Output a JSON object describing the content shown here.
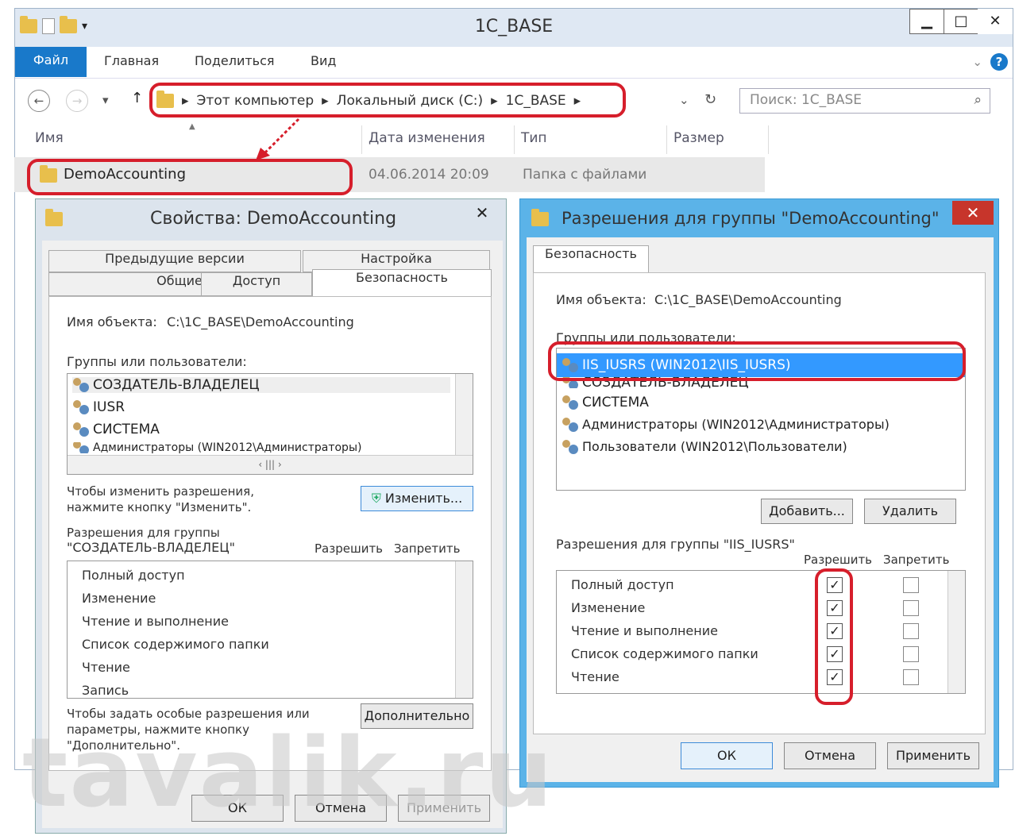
{
  "explorer": {
    "title": "1C_BASE",
    "ribbon": {
      "file": "Файл",
      "home": "Главная",
      "share": "Поделиться",
      "view": "Вид"
    },
    "path": [
      "Этот компьютер",
      "Локальный диск (C:)",
      "1C_BASE"
    ],
    "search_placeholder": "Поиск: 1C_BASE",
    "columns": [
      "Имя",
      "Дата изменения",
      "Тип",
      "Размер"
    ],
    "row": {
      "name": "DemoAccounting",
      "date": "04.06.2014 20:09",
      "type": "Папка с файлами"
    }
  },
  "props": {
    "title": "Свойства: DemoAccounting",
    "tabs": [
      "Предыдущие версии",
      "Настройка",
      "Общие",
      "Доступ",
      "Безопасность"
    ],
    "object_label": "Имя объекта:",
    "object_value": "C:\\1C_BASE\\DemoAccounting",
    "groups_label": "Группы или пользователи:",
    "groups": [
      "СОЗДАТЕЛЬ-ВЛАДЕЛЕЦ",
      "IUSR",
      "СИСТЕМА",
      "Администраторы (WIN2012\\Администраторы)"
    ],
    "change_hint": "Чтобы изменить разрешения,",
    "change_hint2": "нажмите кнопку \"Изменить\".",
    "change_button": "Изменить...",
    "perm_label1": "Разрешения для группы",
    "perm_label2": "\"СОЗДАТЕЛЬ-ВЛАДЕЛЕЦ\"",
    "allow": "Разрешить",
    "deny": "Запретить",
    "perms": [
      "Полный доступ",
      "Изменение",
      "Чтение и выполнение",
      "Список содержимого папки",
      "Чтение",
      "Запись"
    ],
    "adv_hint1": "Чтобы задать особые разрешения или",
    "adv_hint2": "параметры, нажмите кнопку",
    "adv_hint3": "\"Дополнительно\".",
    "adv_button": "Дополнительно",
    "ok": "ОК",
    "cancel": "Отмена",
    "apply": "Применить"
  },
  "perm_dialog": {
    "title": "Разрешения для группы \"DemoAccounting\"",
    "tab": "Безопасность",
    "object_label": "Имя объекта:",
    "object_value": "C:\\1C_BASE\\DemoAccounting",
    "groups_label": "Группы или пользователи:",
    "groups": [
      "IIS_IUSRS (WIN2012\\IIS_IUSRS)",
      "СОЗДАТЕЛЬ-ВЛАДЕЛЕЦ",
      "СИСТЕМА",
      "Администраторы (WIN2012\\Администраторы)",
      "Пользователи (WIN2012\\Пользователи)"
    ],
    "add": "Добавить...",
    "remove": "Удалить",
    "perm_label": "Разрешения для группы \"IIS_IUSRS\"",
    "allow": "Разрешить",
    "deny": "Запретить",
    "perms": [
      "Полный доступ",
      "Изменение",
      "Чтение и выполнение",
      "Список содержимого папки",
      "Чтение"
    ],
    "ok": "ОК",
    "cancel": "Отмена",
    "apply": "Применить"
  },
  "watermark": "tavalik.ru",
  "colors": {
    "accent": "#1979ca",
    "highlight": "#d61e2b",
    "selection": "#3399ff"
  }
}
